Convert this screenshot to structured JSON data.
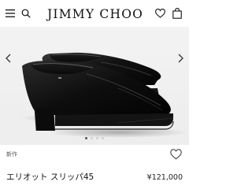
{
  "header": {
    "brand_logo": "JIMMY CHOO",
    "icons": [
      "menu-icon",
      "search-icon",
      "heart-icon",
      "shopping-bag-icon"
    ]
  },
  "product": {
    "image": "black-leather-loafers",
    "badge": "新作",
    "name": "エリオット スリッパ45",
    "price": "¥121,000",
    "carousel": {
      "slide": 1,
      "total": 4
    }
  },
  "colors": {
    "background": "#ffffff",
    "image_background": "#efefef",
    "text": "#111111"
  }
}
